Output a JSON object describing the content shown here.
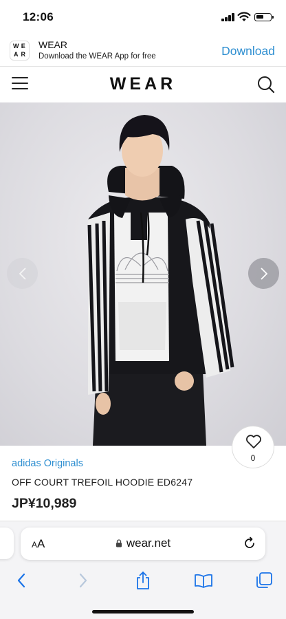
{
  "status_bar": {
    "time": "12:06"
  },
  "app_banner": {
    "logo_letters": [
      "W",
      "E",
      "A",
      "R"
    ],
    "app_name": "WEAR",
    "app_sub": "Download the WEAR App for free",
    "download_label": "Download"
  },
  "header": {
    "logo": "WEAR"
  },
  "product": {
    "brand": "adidas Originals",
    "name": "OFF COURT TREFOIL HOODIE ED6247",
    "price": "JP¥10,989",
    "favorite_count": "0"
  },
  "browser": {
    "text_size_label_small": "A",
    "text_size_label_large": "A",
    "url": "wear.net"
  },
  "colors": {
    "accent": "#2f8fd1",
    "ios_blue": "#1a73e8"
  },
  "icons": [
    "menu-icon",
    "search-icon",
    "chevron-left-icon",
    "chevron-right-icon",
    "heart-icon",
    "lock-icon",
    "reload-icon",
    "back-icon",
    "forward-icon",
    "share-icon",
    "bookmarks-icon",
    "tabs-icon"
  ]
}
